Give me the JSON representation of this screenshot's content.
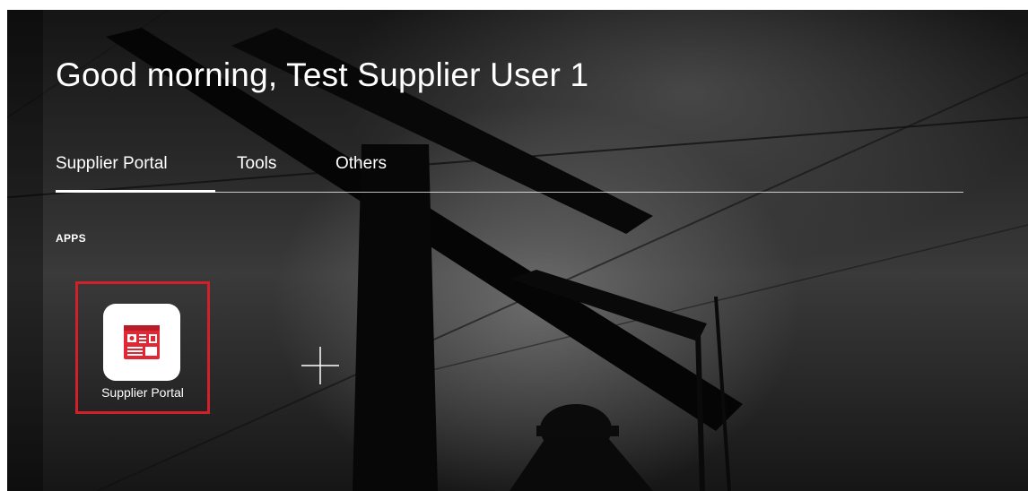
{
  "header": {
    "greeting": "Good morning, Test Supplier User 1"
  },
  "tabs": [
    {
      "label": "Supplier Portal",
      "active": true
    },
    {
      "label": "Tools",
      "active": false
    },
    {
      "label": "Others",
      "active": false
    }
  ],
  "apps_section": {
    "label": "APPS",
    "items": [
      {
        "label": "Supplier Portal",
        "icon": "supplier-portal-icon"
      }
    ],
    "add_icon": "plus-icon"
  },
  "colors": {
    "selection_border": "#d0202a",
    "icon_red": "#e12634",
    "text": "#ffffff"
  }
}
